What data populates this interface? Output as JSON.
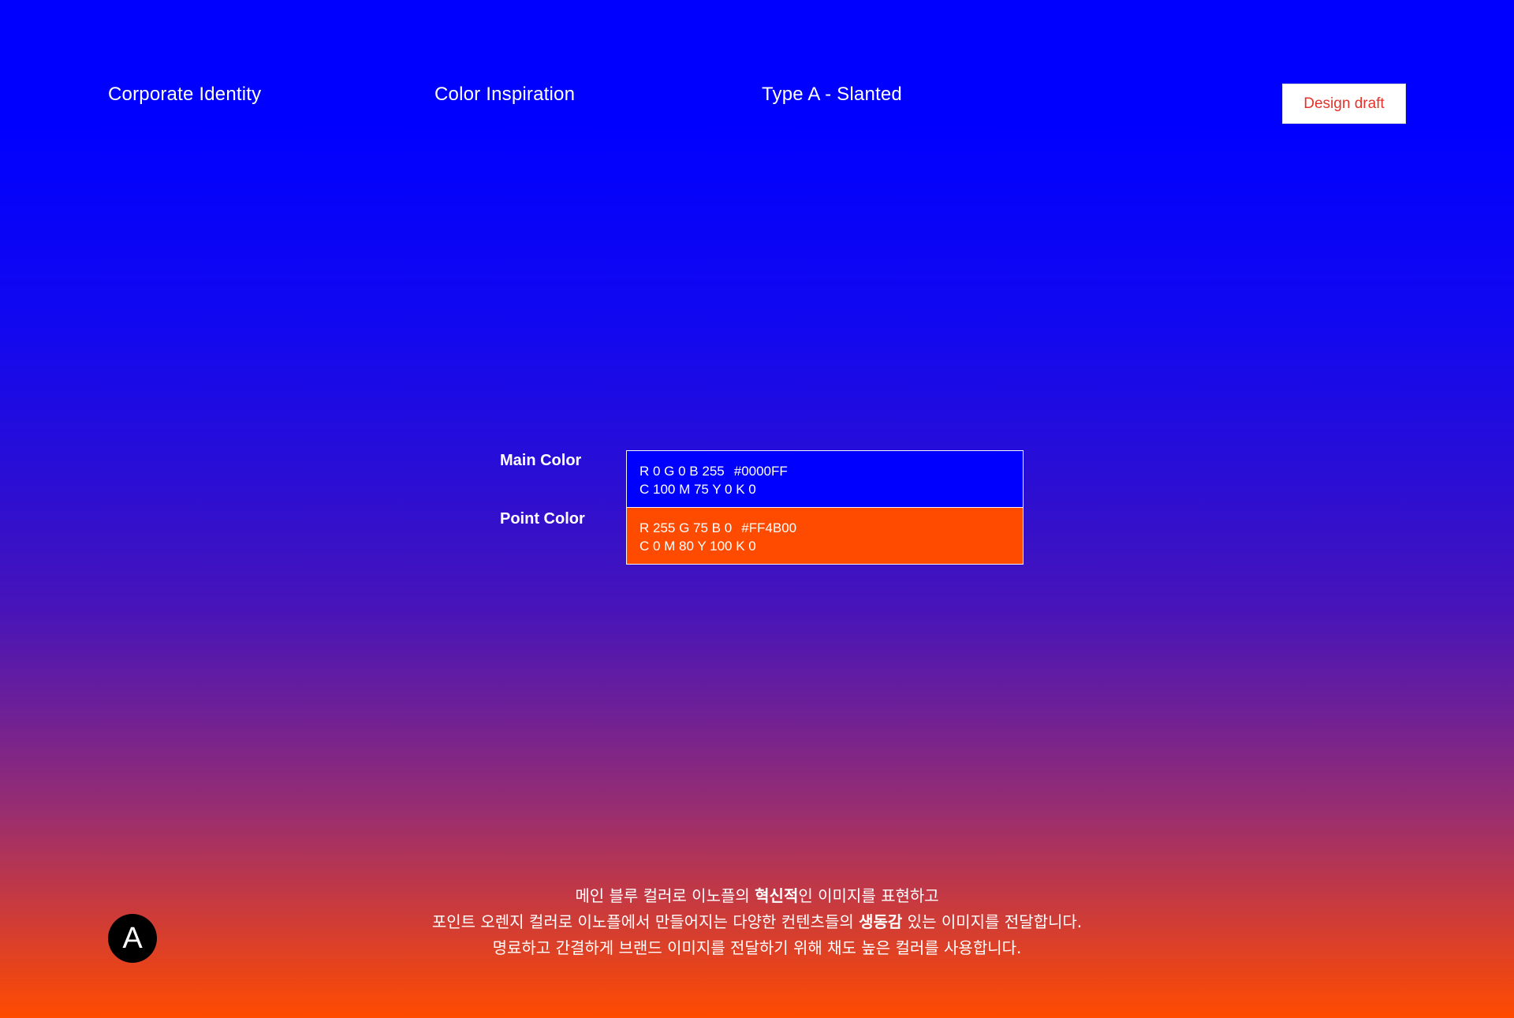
{
  "header": {
    "nav": [
      "Corporate Identity",
      "Color Inspiration",
      "Type A - Slanted"
    ],
    "badge_label": "Design draft"
  },
  "colors": {
    "background_top": "#0000FF",
    "background_bottom": "#FF4B00",
    "draft_text": "#E5322B"
  },
  "swatches": {
    "main": {
      "label": "Main Color",
      "rgb": "R 0 G 0 B 255",
      "hex": "#0000FF",
      "cmyk": "C 100 M 75 Y 0 K 0",
      "fill": "#0000FF"
    },
    "point": {
      "label": "Point Color",
      "rgb": "R 255 G 75 B 0",
      "hex": "#FF4B00",
      "cmyk": "C 0 M 80 Y 100 K 0",
      "fill": "#FF4B00"
    }
  },
  "logo": {
    "letter": "A",
    "icon": "letter-a-logo-icon"
  },
  "description": {
    "line1": {
      "pre": "메인 블루 컬러로 이노플의 ",
      "bold": "혁신적",
      "post": "인 이미지를 표현하고"
    },
    "line2": {
      "pre": "포인트 오렌지 컬러로 이노플에서 만들어지는 다양한 컨텐츠들의 ",
      "bold": "생동감",
      "post": " 있는 이미지를 전달합니다."
    },
    "line3": "명료하고 간결하게 브랜드 이미지를 전달하기 위해 채도 높은 컬러를 사용합니다."
  }
}
